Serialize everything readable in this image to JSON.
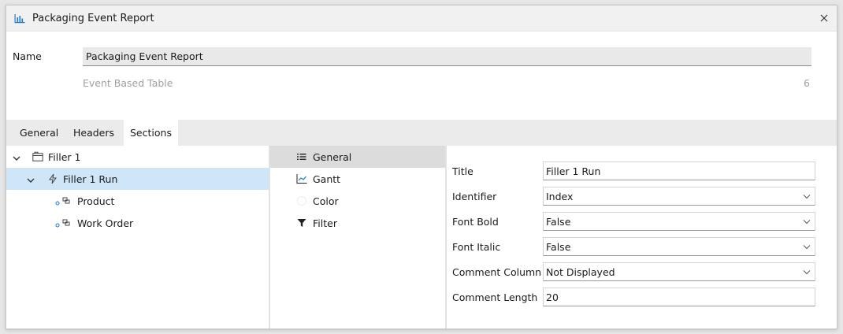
{
  "window": {
    "title": "Packaging Event Report"
  },
  "header": {
    "name_label": "Name",
    "name_value": "Packaging Event Report",
    "subtype": "Event Based Table",
    "count": "6"
  },
  "tabs": [
    {
      "label": "General",
      "active": false
    },
    {
      "label": "Headers",
      "active": false
    },
    {
      "label": "Sections",
      "active": true
    }
  ],
  "tree": [
    {
      "label": "Filler 1",
      "expanded": true,
      "selected": false,
      "icon": "folder-icon"
    },
    {
      "label": "Filler 1 Run",
      "expanded": true,
      "selected": true,
      "icon": "lightning-icon"
    },
    {
      "label": "Product",
      "selected": false,
      "icon": "field-link-icon"
    },
    {
      "label": "Work Order",
      "selected": false,
      "icon": "field-link-icon"
    }
  ],
  "section_list": [
    {
      "label": "General",
      "selected": true,
      "icon": "list-icon"
    },
    {
      "label": "Gantt",
      "selected": false,
      "icon": "gantt-chart-icon"
    },
    {
      "label": "Color",
      "selected": false,
      "icon": "color-circle-icon"
    },
    {
      "label": "Filter",
      "selected": false,
      "icon": "filter-icon"
    }
  ],
  "properties": [
    {
      "label": "Title",
      "value": "Filler 1 Run",
      "type": "text"
    },
    {
      "label": "Identifier",
      "value": "Index",
      "type": "select"
    },
    {
      "label": "Font Bold",
      "value": "False",
      "type": "select"
    },
    {
      "label": "Font Italic",
      "value": "False",
      "type": "select"
    },
    {
      "label": "Comment Column",
      "value": "Not Displayed",
      "type": "select"
    },
    {
      "label": "Comment Length",
      "value": "20",
      "type": "text"
    }
  ],
  "colors": {
    "accent": "#1f7ac8",
    "selection": "#cfe6f8"
  }
}
